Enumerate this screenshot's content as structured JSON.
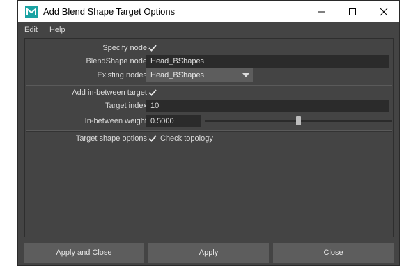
{
  "window": {
    "title": "Add Blend Shape Target Options"
  },
  "menu": {
    "items": [
      "Edit",
      "Help"
    ]
  },
  "form": {
    "specify_node": {
      "label": "Specify node:",
      "checked": true
    },
    "blendshape_node": {
      "label": "BlendShape node:",
      "value": "Head_BShapes"
    },
    "existing_nodes": {
      "label": "Existing nodes:",
      "value": "Head_BShapes"
    },
    "add_inbetween": {
      "label": "Add in-between target:",
      "checked": true
    },
    "target_index": {
      "label": "Target index:",
      "value": "10"
    },
    "inbetween_weight": {
      "label": "In-between weight:",
      "value": "0.5000",
      "slider_fraction": 0.5
    },
    "target_shape_options": {
      "label": "Target shape options:",
      "check_topology_label": "Check topology",
      "checked": true
    }
  },
  "buttons": {
    "apply_close": "Apply and Close",
    "apply": "Apply",
    "close": "Close"
  },
  "colors": {
    "bg": "#444444",
    "field": "#2b2b2b",
    "button": "#5d5d5d",
    "icon_teal": "#1aa3a3"
  }
}
